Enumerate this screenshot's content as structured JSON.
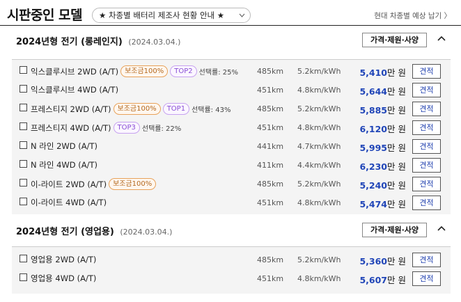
{
  "header": {
    "title": "시판중인 모델",
    "notice": "★ 차종별 배터리 제조사 현황 안내 ★",
    "delivery_link": "현대 차종별 예상 납기 〉"
  },
  "sections": [
    {
      "title": "2024년형 전기 (롱레인지)",
      "date": "(2024.03.04.)",
      "spec_label": "가격·제원·사양",
      "rows": [
        {
          "trim": "익스클루시브 2WD (A/T)",
          "subsidy": "보조금100%",
          "top": "TOP2",
          "pick": "선택률: 25%",
          "range": "485km",
          "eff": "5.2km/kWh",
          "price": "5,410",
          "unit": "만 원",
          "quote": "견적"
        },
        {
          "trim": "익스클루시브 4WD (A/T)",
          "subsidy": "",
          "top": "",
          "pick": "",
          "range": "451km",
          "eff": "4.8km/kWh",
          "price": "5,644",
          "unit": "만 원",
          "quote": "견적"
        },
        {
          "trim": "프레스티지 2WD (A/T)",
          "subsidy": "보조금100%",
          "top": "TOP1",
          "pick": "선택률: 43%",
          "range": "485km",
          "eff": "5.2km/kWh",
          "price": "5,885",
          "unit": "만 원",
          "quote": "견적"
        },
        {
          "trim": "프레스티지 4WD (A/T)",
          "subsidy": "",
          "top": "TOP3",
          "pick": "선택률: 22%",
          "range": "451km",
          "eff": "4.8km/kWh",
          "price": "6,120",
          "unit": "만 원",
          "quote": "견적"
        },
        {
          "trim": "N 라인 2WD (A/T)",
          "subsidy": "",
          "top": "",
          "pick": "",
          "range": "441km",
          "eff": "4.7km/kWh",
          "price": "5,995",
          "unit": "만 원",
          "quote": "견적"
        },
        {
          "trim": "N 라인 4WD (A/T)",
          "subsidy": "",
          "top": "",
          "pick": "",
          "range": "411km",
          "eff": "4.4km/kWh",
          "price": "6,230",
          "unit": "만 원",
          "quote": "견적"
        },
        {
          "trim": "이-라이트 2WD (A/T)",
          "subsidy": "보조금100%",
          "top": "",
          "pick": "",
          "range": "485km",
          "eff": "5.2km/kWh",
          "price": "5,240",
          "unit": "만 원",
          "quote": "견적"
        },
        {
          "trim": "이-라이트 4WD (A/T)",
          "subsidy": "",
          "top": "",
          "pick": "",
          "range": "451km",
          "eff": "4.8km/kWh",
          "price": "5,474",
          "unit": "만 원",
          "quote": "견적"
        }
      ]
    },
    {
      "title": "2024년형 전기 (영업용)",
      "date": "(2024.03.04.)",
      "spec_label": "가격·제원·사양",
      "rows": [
        {
          "trim": "영업용 2WD (A/T)",
          "subsidy": "",
          "top": "",
          "pick": "",
          "range": "485km",
          "eff": "5.2km/kWh",
          "price": "5,360",
          "unit": "만 원",
          "quote": "견적"
        },
        {
          "trim": "영업용 4WD (A/T)",
          "subsidy": "",
          "top": "",
          "pick": "",
          "range": "451km",
          "eff": "4.8km/kWh",
          "price": "5,607",
          "unit": "만 원",
          "quote": "견적"
        }
      ]
    }
  ],
  "colors": {
    "price_blue": "#2146b8",
    "subsidy_orange": "#e8a25a",
    "top_purple": "#c7a2f0",
    "list_bg": "#f4f4f4"
  }
}
